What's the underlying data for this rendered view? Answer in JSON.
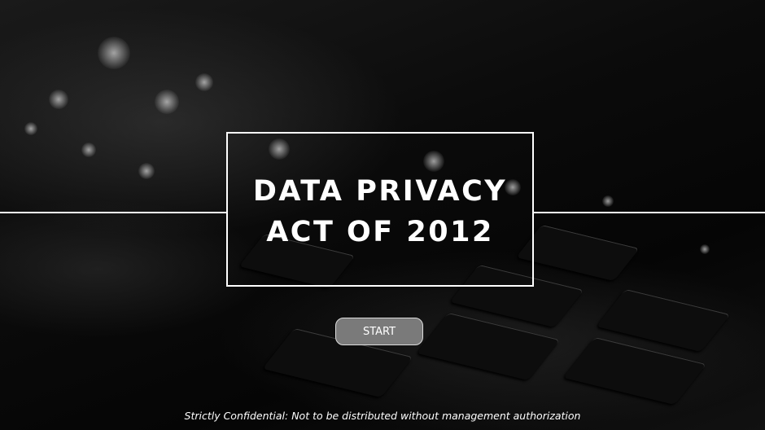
{
  "slide": {
    "title_line1": "DATA PRIVACY",
    "title_line2": "ACT OF 2012",
    "start_label": "START",
    "footer": "Strictly Confidential: Not to be distributed without management authorization"
  },
  "colors": {
    "background": "#050505",
    "button": "#7a7a7a",
    "text": "#ffffff"
  }
}
